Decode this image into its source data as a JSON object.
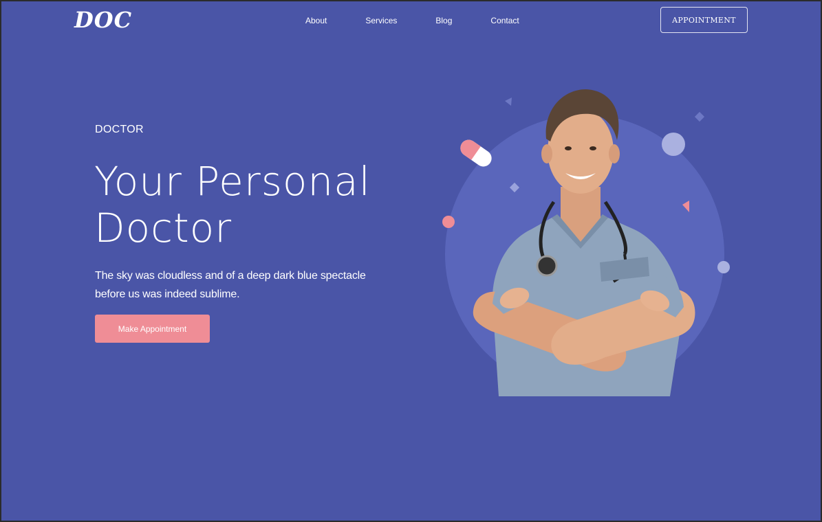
{
  "header": {
    "logo": "DOC",
    "nav": [
      "About",
      "Services",
      "Blog",
      "Contact"
    ],
    "appointment_label": "APPOINTMENT"
  },
  "hero": {
    "eyebrow": "DOCTOR",
    "title_line1": "Your Personal",
    "title_line2": "Doctor",
    "subtitle_line1": "The sky was cloudless and of a deep dark blue spectacle",
    "subtitle_line2": "before us was indeed sublime.",
    "cta_label": "Make Appointment"
  },
  "colors": {
    "background": "#4a55a7",
    "circle": "#5a66bb",
    "accent_pink": "#ef8d96",
    "text": "#ffffff",
    "scrubs": "#8fa4bd"
  },
  "icons": [
    "doctor-photo",
    "pill-icon",
    "circle-decoration",
    "triangle-decoration",
    "diamond-decoration"
  ]
}
